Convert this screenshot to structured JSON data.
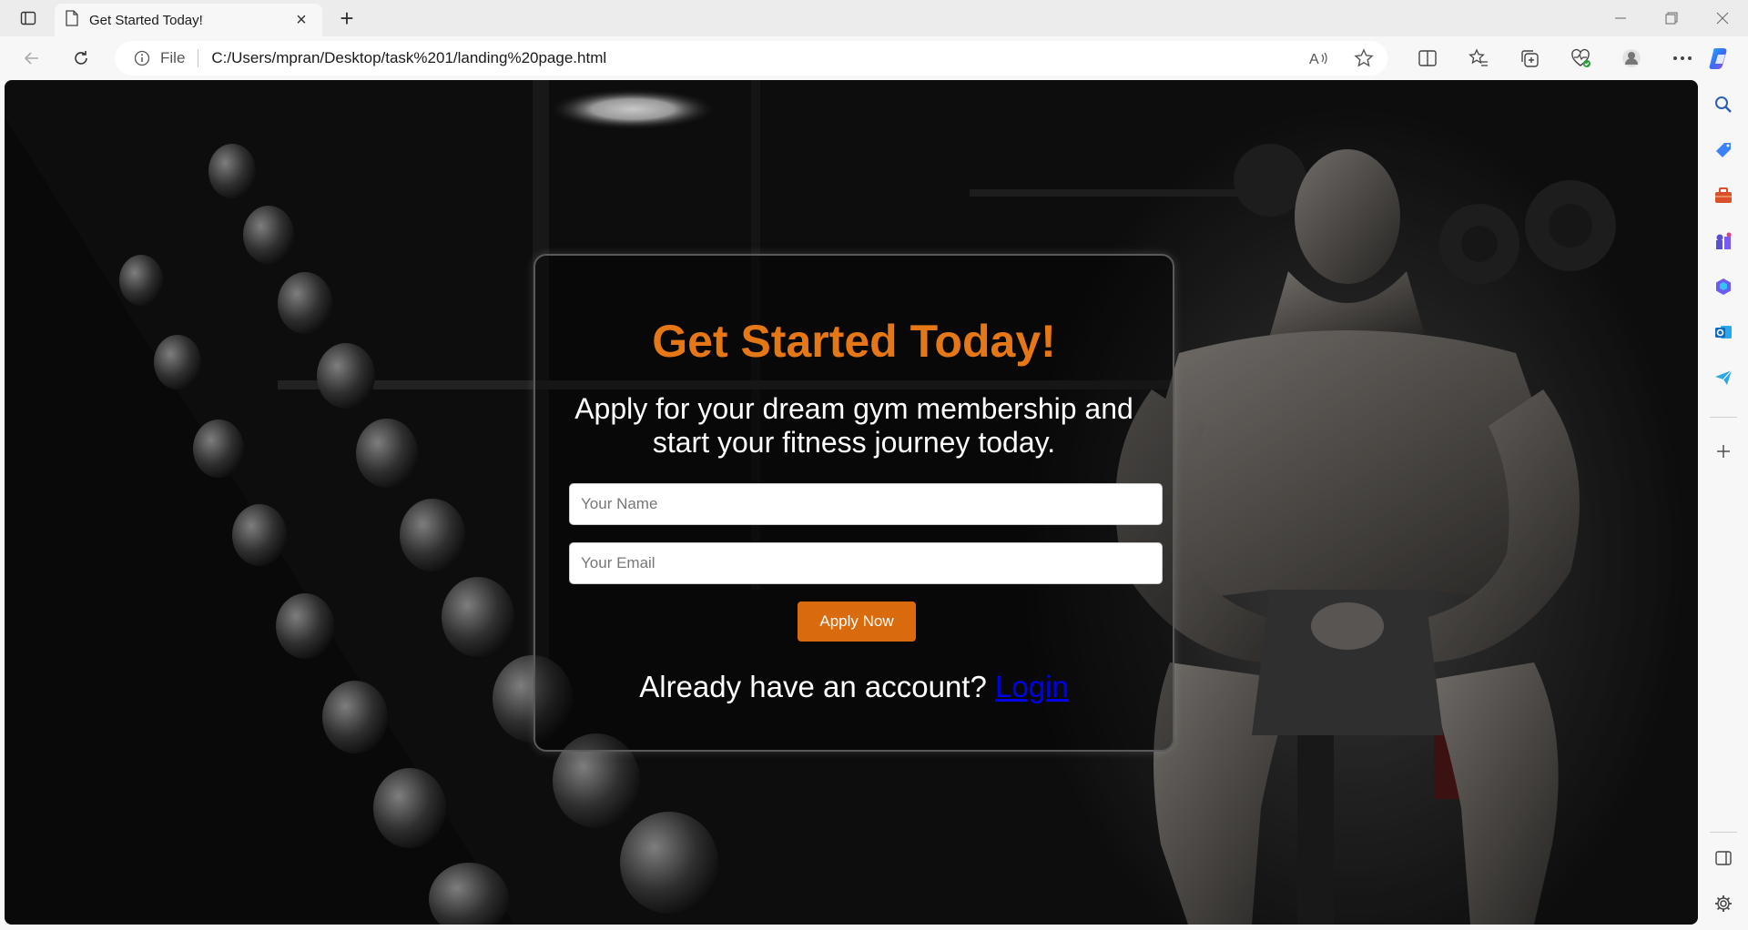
{
  "browser": {
    "tab_title": "Get Started Today!",
    "new_tab_symbol": "+",
    "scheme_label": "File",
    "url": "C:/Users/mpran/Desktop/task%201/landing%20page.html"
  },
  "page": {
    "heading": "Get Started Today!",
    "subheading": "Apply for your dream gym membership and start your fitness journey today.",
    "name_placeholder": "Your Name",
    "email_placeholder": "Your Email",
    "apply_label": "Apply Now",
    "login_prompt": "Already have an account?",
    "login_link": "Login"
  },
  "colors": {
    "accent": "#e67716",
    "button": "#d96a0d",
    "link": "#0000ee"
  },
  "icons": {
    "toolbar": [
      "read-aloud-icon",
      "favorite-star-icon",
      "split-screen-icon",
      "favorites-icon",
      "collections-icon",
      "browser-essentials-icon",
      "profile-icon",
      "more-icon",
      "copilot-icon"
    ],
    "sidebar": [
      "search-icon",
      "shopping-icon",
      "tools-icon",
      "games-icon",
      "microsoft-365-icon",
      "outlook-icon",
      "drop-icon",
      "add-icon",
      "sidebar-toggle-icon",
      "settings-icon"
    ]
  }
}
